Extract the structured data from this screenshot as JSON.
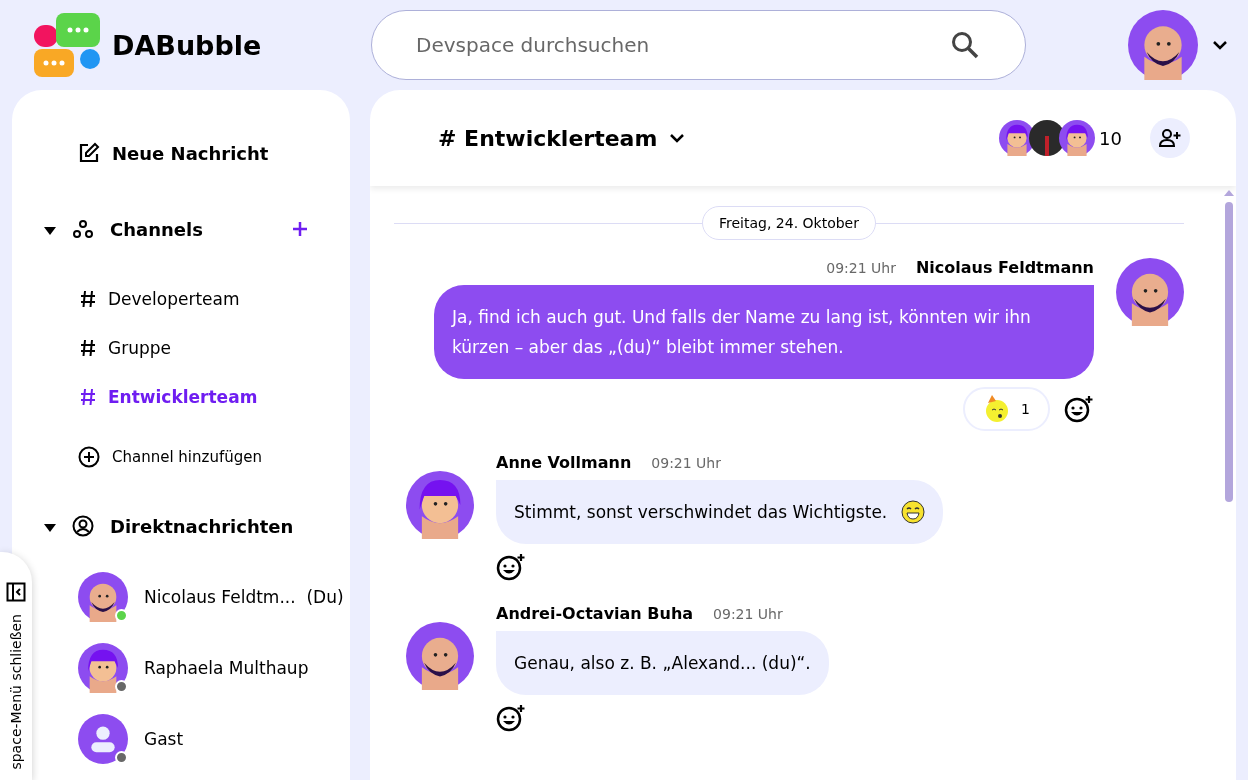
{
  "header": {
    "logo": "DABubble",
    "search": {
      "placeholder": "Devspace durchsuchen"
    }
  },
  "sidebar": {
    "new_message": "Neue Nachricht",
    "channels": {
      "title": "Channels",
      "expanded": true,
      "items": [
        {
          "label": "Developerteam",
          "selected": false
        },
        {
          "label": "Gruppe",
          "selected": false
        },
        {
          "label": "Entwicklerteam",
          "selected": true
        }
      ],
      "add": "Channel hinzufügen"
    },
    "direct": {
      "title": "Direktnachrichten",
      "expanded": true,
      "items": [
        {
          "name": "Nicolaus Feldtm...",
          "suffix": "(Du)",
          "online": true,
          "avatar": {
            "kind": "bald"
          }
        },
        {
          "name": "Raphaela Multhaup",
          "online": false,
          "avatar": {
            "kind": "hair"
          }
        },
        {
          "name": "Gast",
          "online": false,
          "avatar": {
            "kind": "guest"
          }
        }
      ]
    },
    "toggle": "space-Menü schließen"
  },
  "channel": {
    "prefix": "#",
    "title": "Entwicklerteam",
    "member_count": "10"
  },
  "date_divider": "Freitag, 24. Oktober",
  "messages": [
    {
      "kind": "own",
      "author": "Nicolaus Feldtmann",
      "time": "09:21 Uhr",
      "avatar": {
        "kind": "bald"
      },
      "text": "Ja, find ich auch gut. Und falls der Name zu lang ist, könnten wir ihn kürzen – aber das „(du)“ bleibt immer stehen.",
      "reactions": [
        {
          "count": "1"
        }
      ]
    },
    {
      "kind": "other",
      "author": "Anne Vollmann",
      "time": "09:21 Uhr",
      "avatar": {
        "kind": "hair"
      },
      "text": "Stimmt, sonst verschwindet das Wichtigste.",
      "emoji": true
    },
    {
      "kind": "other",
      "author": "Andrei-Octavian Buha",
      "time": "09:21 Uhr",
      "avatar": {
        "kind": "bald"
      },
      "text": "Genau, also z. B. „Alexand... (du)“.",
      "emoji": false
    }
  ]
}
